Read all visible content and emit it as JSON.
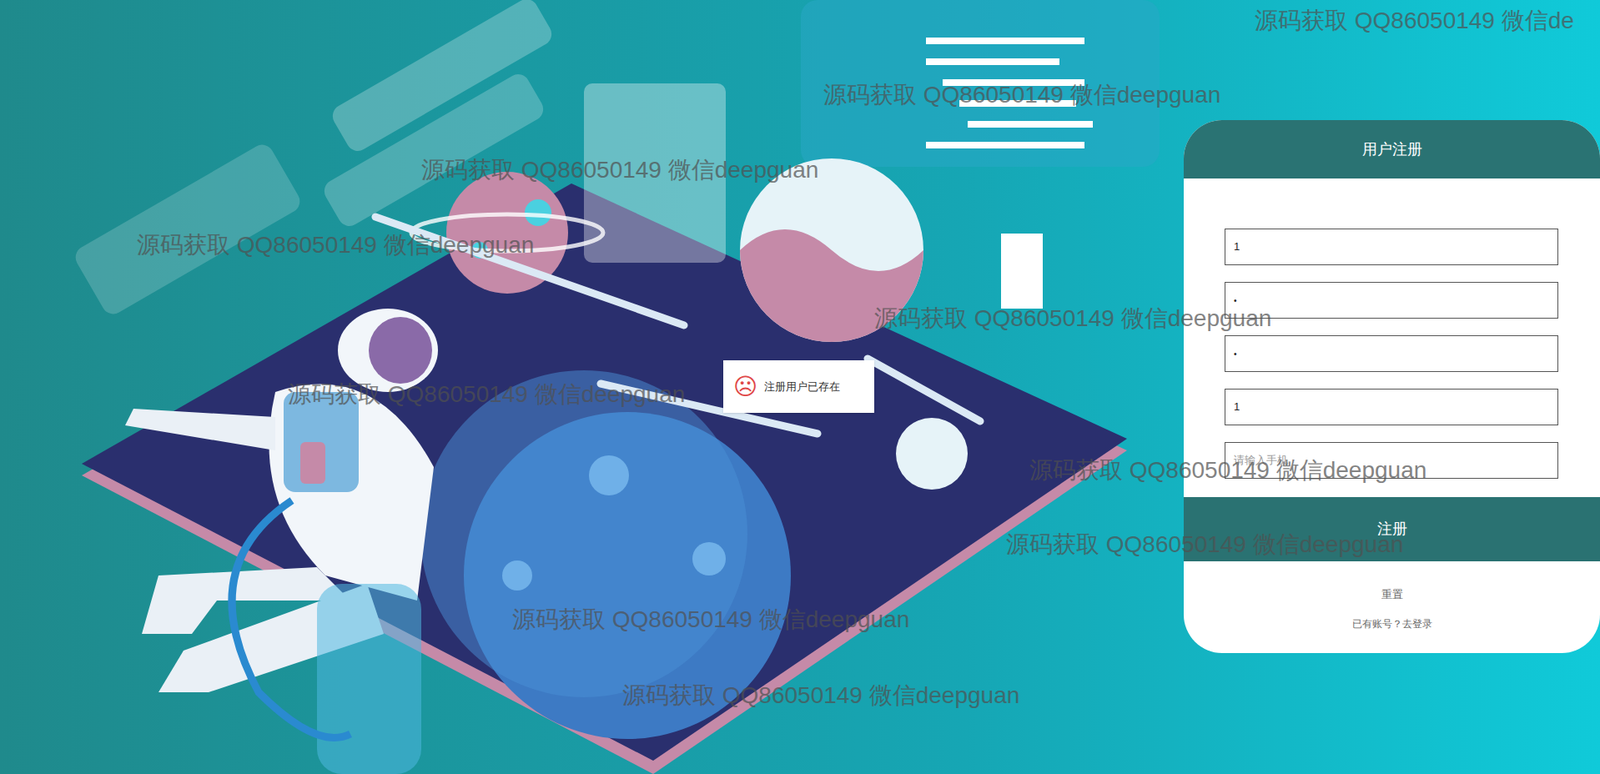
{
  "form": {
    "title": "用户注册",
    "fields": [
      {
        "kind": "text",
        "value": "1",
        "placeholder": ""
      },
      {
        "kind": "password",
        "value": "•",
        "placeholder": ""
      },
      {
        "kind": "password",
        "value": "•",
        "placeholder": ""
      },
      {
        "kind": "text",
        "value": "1",
        "placeholder": ""
      },
      {
        "kind": "text",
        "value": "",
        "placeholder": "请输入手机"
      }
    ],
    "submit": "注册",
    "reset": "重置",
    "login_link": "已有账号？去登录"
  },
  "toast": {
    "icon": "☹",
    "message": "注册用户已存在"
  },
  "watermarks": [
    "源码获取 QQ86050149 微信de",
    "源码获取 QQ86050149 微信deepguan",
    "源码获取 QQ86050149 微信deepguan",
    "源码获取 QQ86050149 微信deepguan",
    "源码获取 QQ86050149 微信deepguan",
    "源码获取 QQ86050149 微信deepguan",
    "源码获取 QQ86050149 微信deepguan",
    "源码获取 QQ86050149 微信deepguan",
    "源码获取 QQ86050149 微信deepguan",
    "源码获取 QQ86050149 微信deepguan"
  ]
}
